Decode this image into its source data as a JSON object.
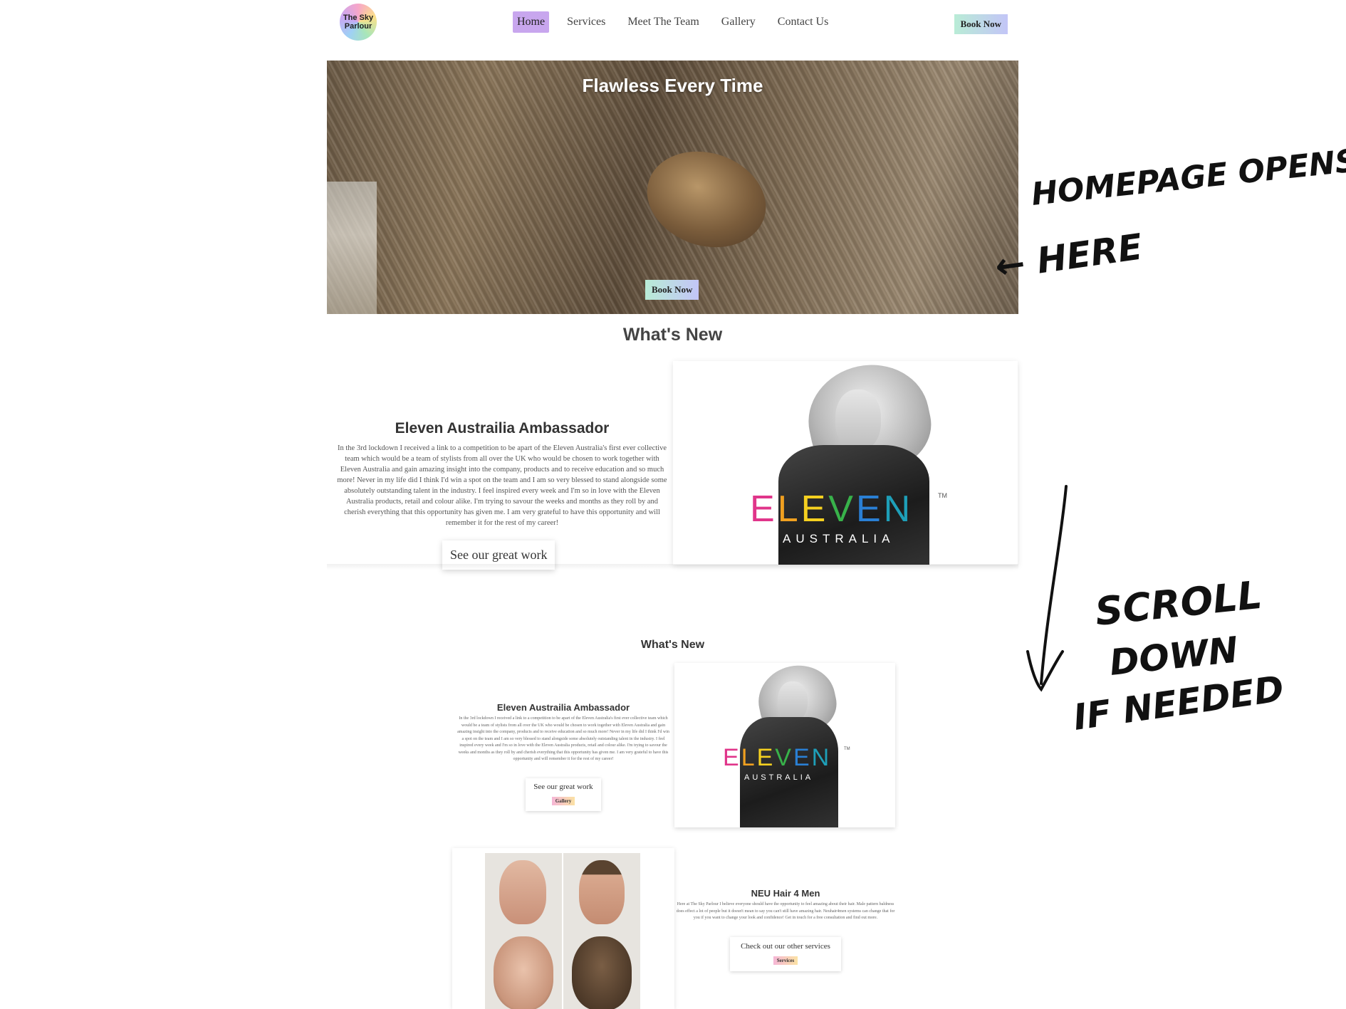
{
  "nav": {
    "logo_line1": "The Sky",
    "logo_line2": "Parlour",
    "links": [
      "Home",
      "Services",
      "Meet The Team",
      "Gallery",
      "Contact Us"
    ],
    "book_label": "Book Now"
  },
  "hero": {
    "title": "Flawless Every Time",
    "button": "Book Now"
  },
  "whats_new": {
    "heading": "What's New",
    "card_title": "Eleven Austrailia Ambassador",
    "card_body": "In the 3rd lockdown I received a link to a competition to be apart of the Eleven Australia's first ever collective team which would be a team of stylists from all over the UK who would be chosen to work together with Eleven Australia and gain amazing insight into the company, products and to receive education and so much more! Never in my life did I think I'd win a spot on the team and I am so very blessed to stand alongside some absolutely outstanding talent in the industry. I feel inspired every week and I'm so in love with the Eleven Australia products, retail and colour alike. I'm trying to savour the weeks and months as they roll by and cherish everything that this opportunity has given me. I am very grateful to have this opportunity and will remember it for the rest of my career!",
    "work_button": "See our great work"
  },
  "eleven_logo": {
    "letters": [
      "E",
      "L",
      "E",
      "V",
      "E",
      "N"
    ],
    "letter_colors": [
      "#e0358a",
      "#f0a020",
      "#f5d020",
      "#38b24a",
      "#2a7fd4",
      "#1e9fb8"
    ],
    "tm": "TM",
    "subline": "AUSTRALIA"
  },
  "whats_new_small": {
    "heading": "What's New",
    "card_title": "Eleven Austrailia Ambassador",
    "work_label": "See our great work",
    "work_pill": "Gallery"
  },
  "neu": {
    "title": "NEU Hair 4 Men",
    "body": "Here at The Sky Parlour I believe everyone should have the opportunity to feel amazing about their hair. Male pattern baldness does effect a lot of people but it doesn't mean to say you can't still have amazing hair. Neuhair4men systems can change that for you if you want to change your look and confidence! Get in touch for a free consultation and find out more.",
    "services_label": "Check out our other services",
    "services_pill": "Services"
  },
  "annotations": {
    "note1_line1": "HOMEPAGE OPENS",
    "note1_line2": "← HERE",
    "note2_line1": "SCROLL",
    "note2_line2": "DOWN",
    "note2_line3": "IF NEEDED"
  },
  "colors": {
    "nav_active": "#c8a6ee",
    "button_gradient_start": "#b9ecd6",
    "button_gradient_end": "#c3c5f7",
    "pill_gradient_start": "#f5b6d6",
    "pill_gradient_end": "#fbe2a4"
  }
}
